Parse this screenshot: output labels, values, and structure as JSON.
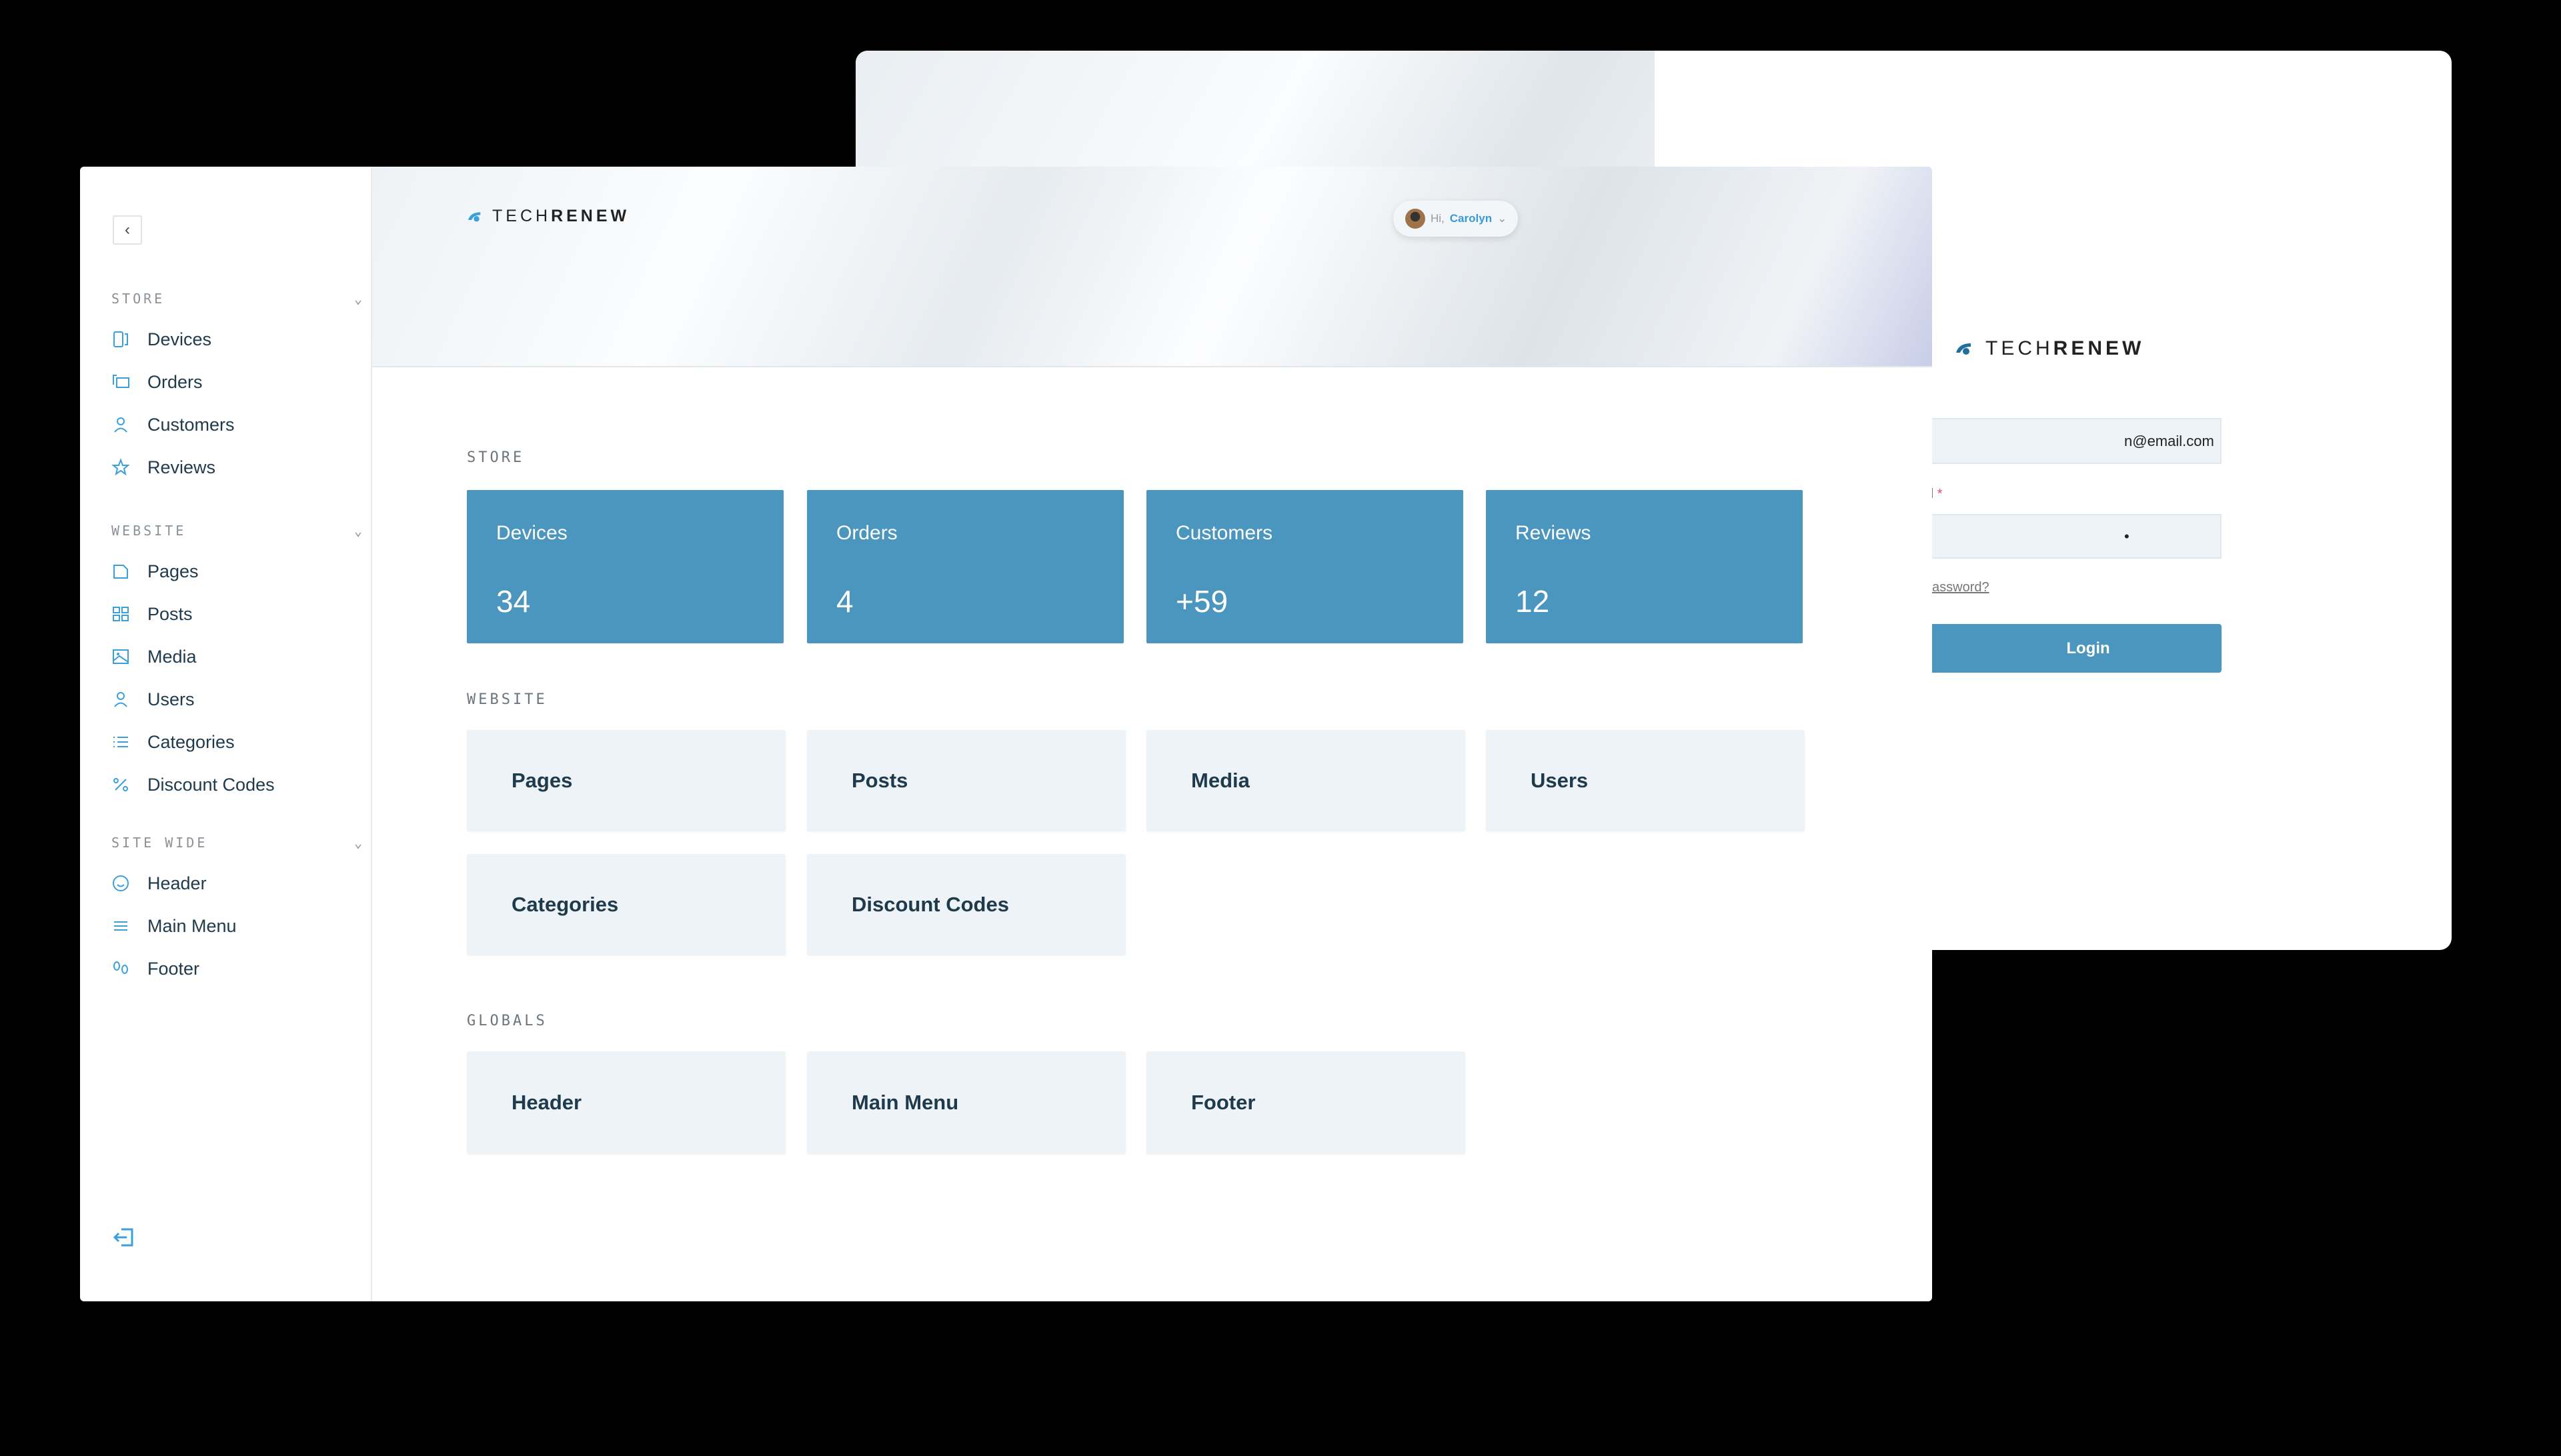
{
  "brand": {
    "light": "TECH",
    "bold": "RENEW"
  },
  "colors": {
    "accent": "#4a96bf",
    "icon": "#3ba0d8",
    "card_light": "#edf3f6",
    "text": "#1e3a4c"
  },
  "login": {
    "email_value": "n@email.com",
    "password_label": "d",
    "required_mark": "*",
    "password_value": "•",
    "forgot": "assword?",
    "button": "Login"
  },
  "header": {
    "greeting": "Hi,",
    "user": "Carolyn"
  },
  "sidebar": {
    "sections": [
      {
        "label": "STORE",
        "items": [
          {
            "label": "Devices",
            "icon": "device-icon"
          },
          {
            "label": "Orders",
            "icon": "orders-icon"
          },
          {
            "label": "Customers",
            "icon": "user-icon"
          },
          {
            "label": "Reviews",
            "icon": "star-icon"
          }
        ]
      },
      {
        "label": "WEBSITE",
        "items": [
          {
            "label": "Pages",
            "icon": "page-icon"
          },
          {
            "label": "Posts",
            "icon": "grid-icon"
          },
          {
            "label": "Media",
            "icon": "image-icon"
          },
          {
            "label": "Users",
            "icon": "user-icon"
          },
          {
            "label": "Categories",
            "icon": "list-icon"
          },
          {
            "label": "Discount Codes",
            "icon": "percent-icon"
          }
        ]
      },
      {
        "label": "SITE WIDE",
        "items": [
          {
            "label": "Header",
            "icon": "smile-icon"
          },
          {
            "label": "Main Menu",
            "icon": "menu-icon"
          },
          {
            "label": "Footer",
            "icon": "footprints-icon"
          }
        ]
      }
    ]
  },
  "main": {
    "store_label": "STORE",
    "store_cards": [
      {
        "title": "Devices",
        "value": "34"
      },
      {
        "title": "Orders",
        "value": "4"
      },
      {
        "title": "Customers",
        "value": "+59"
      },
      {
        "title": "Reviews",
        "value": "12"
      }
    ],
    "website_label": "WEBSITE",
    "website_cards": [
      "Pages",
      "Posts",
      "Media",
      "Users",
      "Categories",
      "Discount Codes"
    ],
    "globals_label": "GLOBALS",
    "globals_cards": [
      "Header",
      "Main Menu",
      "Footer"
    ]
  }
}
